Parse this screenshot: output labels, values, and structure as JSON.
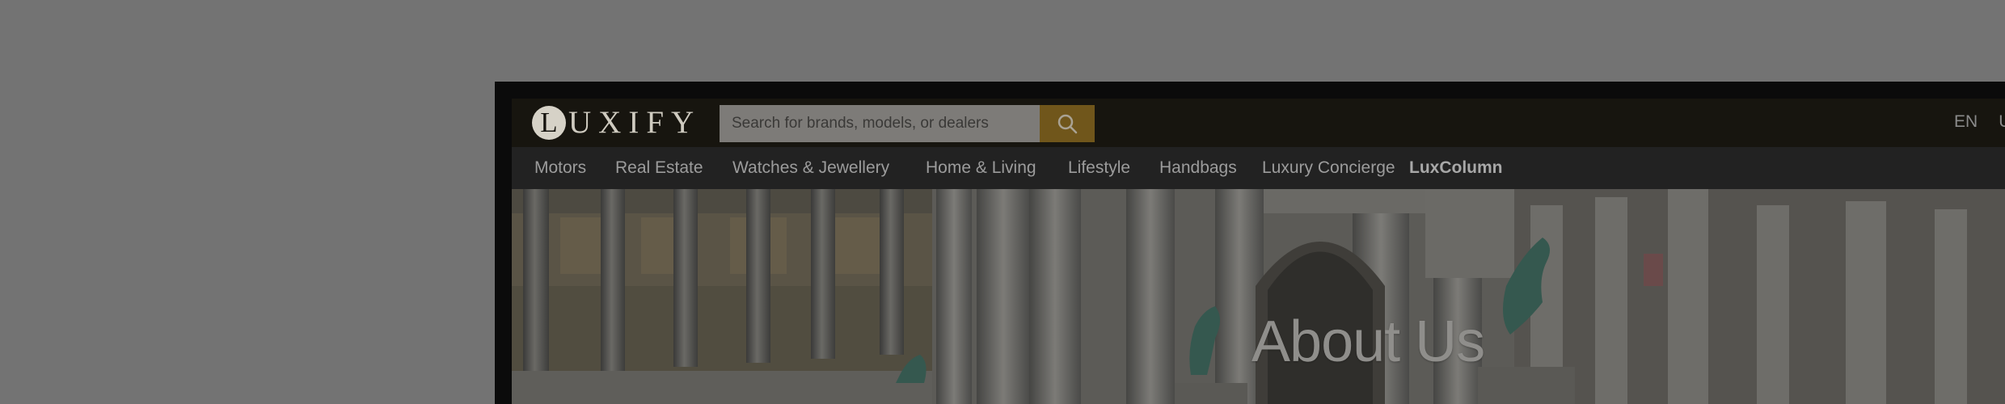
{
  "logo": {
    "letter": "L",
    "word": "UXIFY"
  },
  "search": {
    "placeholder": "Search for brands, models, or dealers",
    "icon": "search-icon"
  },
  "lang": {
    "current": "EN",
    "next": "U"
  },
  "nav": {
    "items": [
      {
        "label": "Motors"
      },
      {
        "label": "Real Estate"
      },
      {
        "label": "Watches & Jewellery"
      },
      {
        "label": "Home & Living"
      },
      {
        "label": "Lifestyle"
      },
      {
        "label": "Handbags"
      },
      {
        "label": "Luxury Concierge"
      },
      {
        "label": "LuxColumn"
      }
    ]
  },
  "hero": {
    "title": "About Us"
  },
  "colors": {
    "overlay": "#737373",
    "accent_gold": "#70561b",
    "header": "#17150f",
    "nav": "#222222"
  }
}
